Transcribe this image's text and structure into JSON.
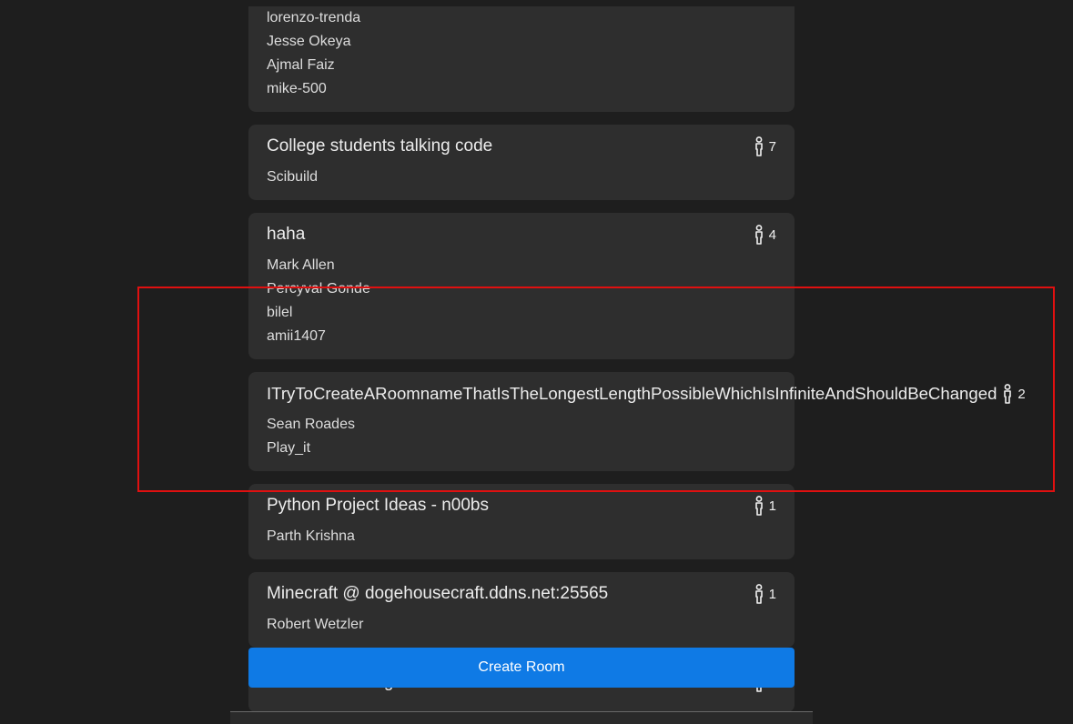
{
  "rooms": [
    {
      "title": "",
      "count": "",
      "members": [
        "lorenzo-trenda",
        "Jesse Okeya",
        "Ajmal Faiz",
        "mike-500"
      ]
    },
    {
      "title": "College students talking code",
      "count": "7",
      "members": [
        "Scibuild"
      ]
    },
    {
      "title": "haha",
      "count": "4",
      "members": [
        "Mark Allen",
        "Percyval Gonde",
        "bilel",
        "amii1407"
      ]
    },
    {
      "title": "ITryToCreateARoomnameThatIsTheLongestLengthPossibleWhichIsInfiniteAndShouldBeChanged",
      "count": "2",
      "members": [
        "Sean Roades",
        "Play_it"
      ]
    },
    {
      "title": "Python Project Ideas - n00bs",
      "count": "1",
      "members": [
        "Parth Krishna"
      ]
    },
    {
      "title": "Minecraft @ dogehousecraft.ddns.net:25565",
      "count": "1",
      "members": [
        "Robert Wetzler"
      ]
    },
    {
      "title": "Is Bitcoin too high?",
      "count": "1",
      "members": [
        ""
      ]
    }
  ],
  "create_button": {
    "label": "Create Room"
  },
  "icons": {
    "member_count": "person-icon"
  },
  "colors": {
    "background": "#1e1e1e",
    "card": "#2e2e2e",
    "primary_button": "#0f7ae5",
    "highlight": "#e01010"
  }
}
